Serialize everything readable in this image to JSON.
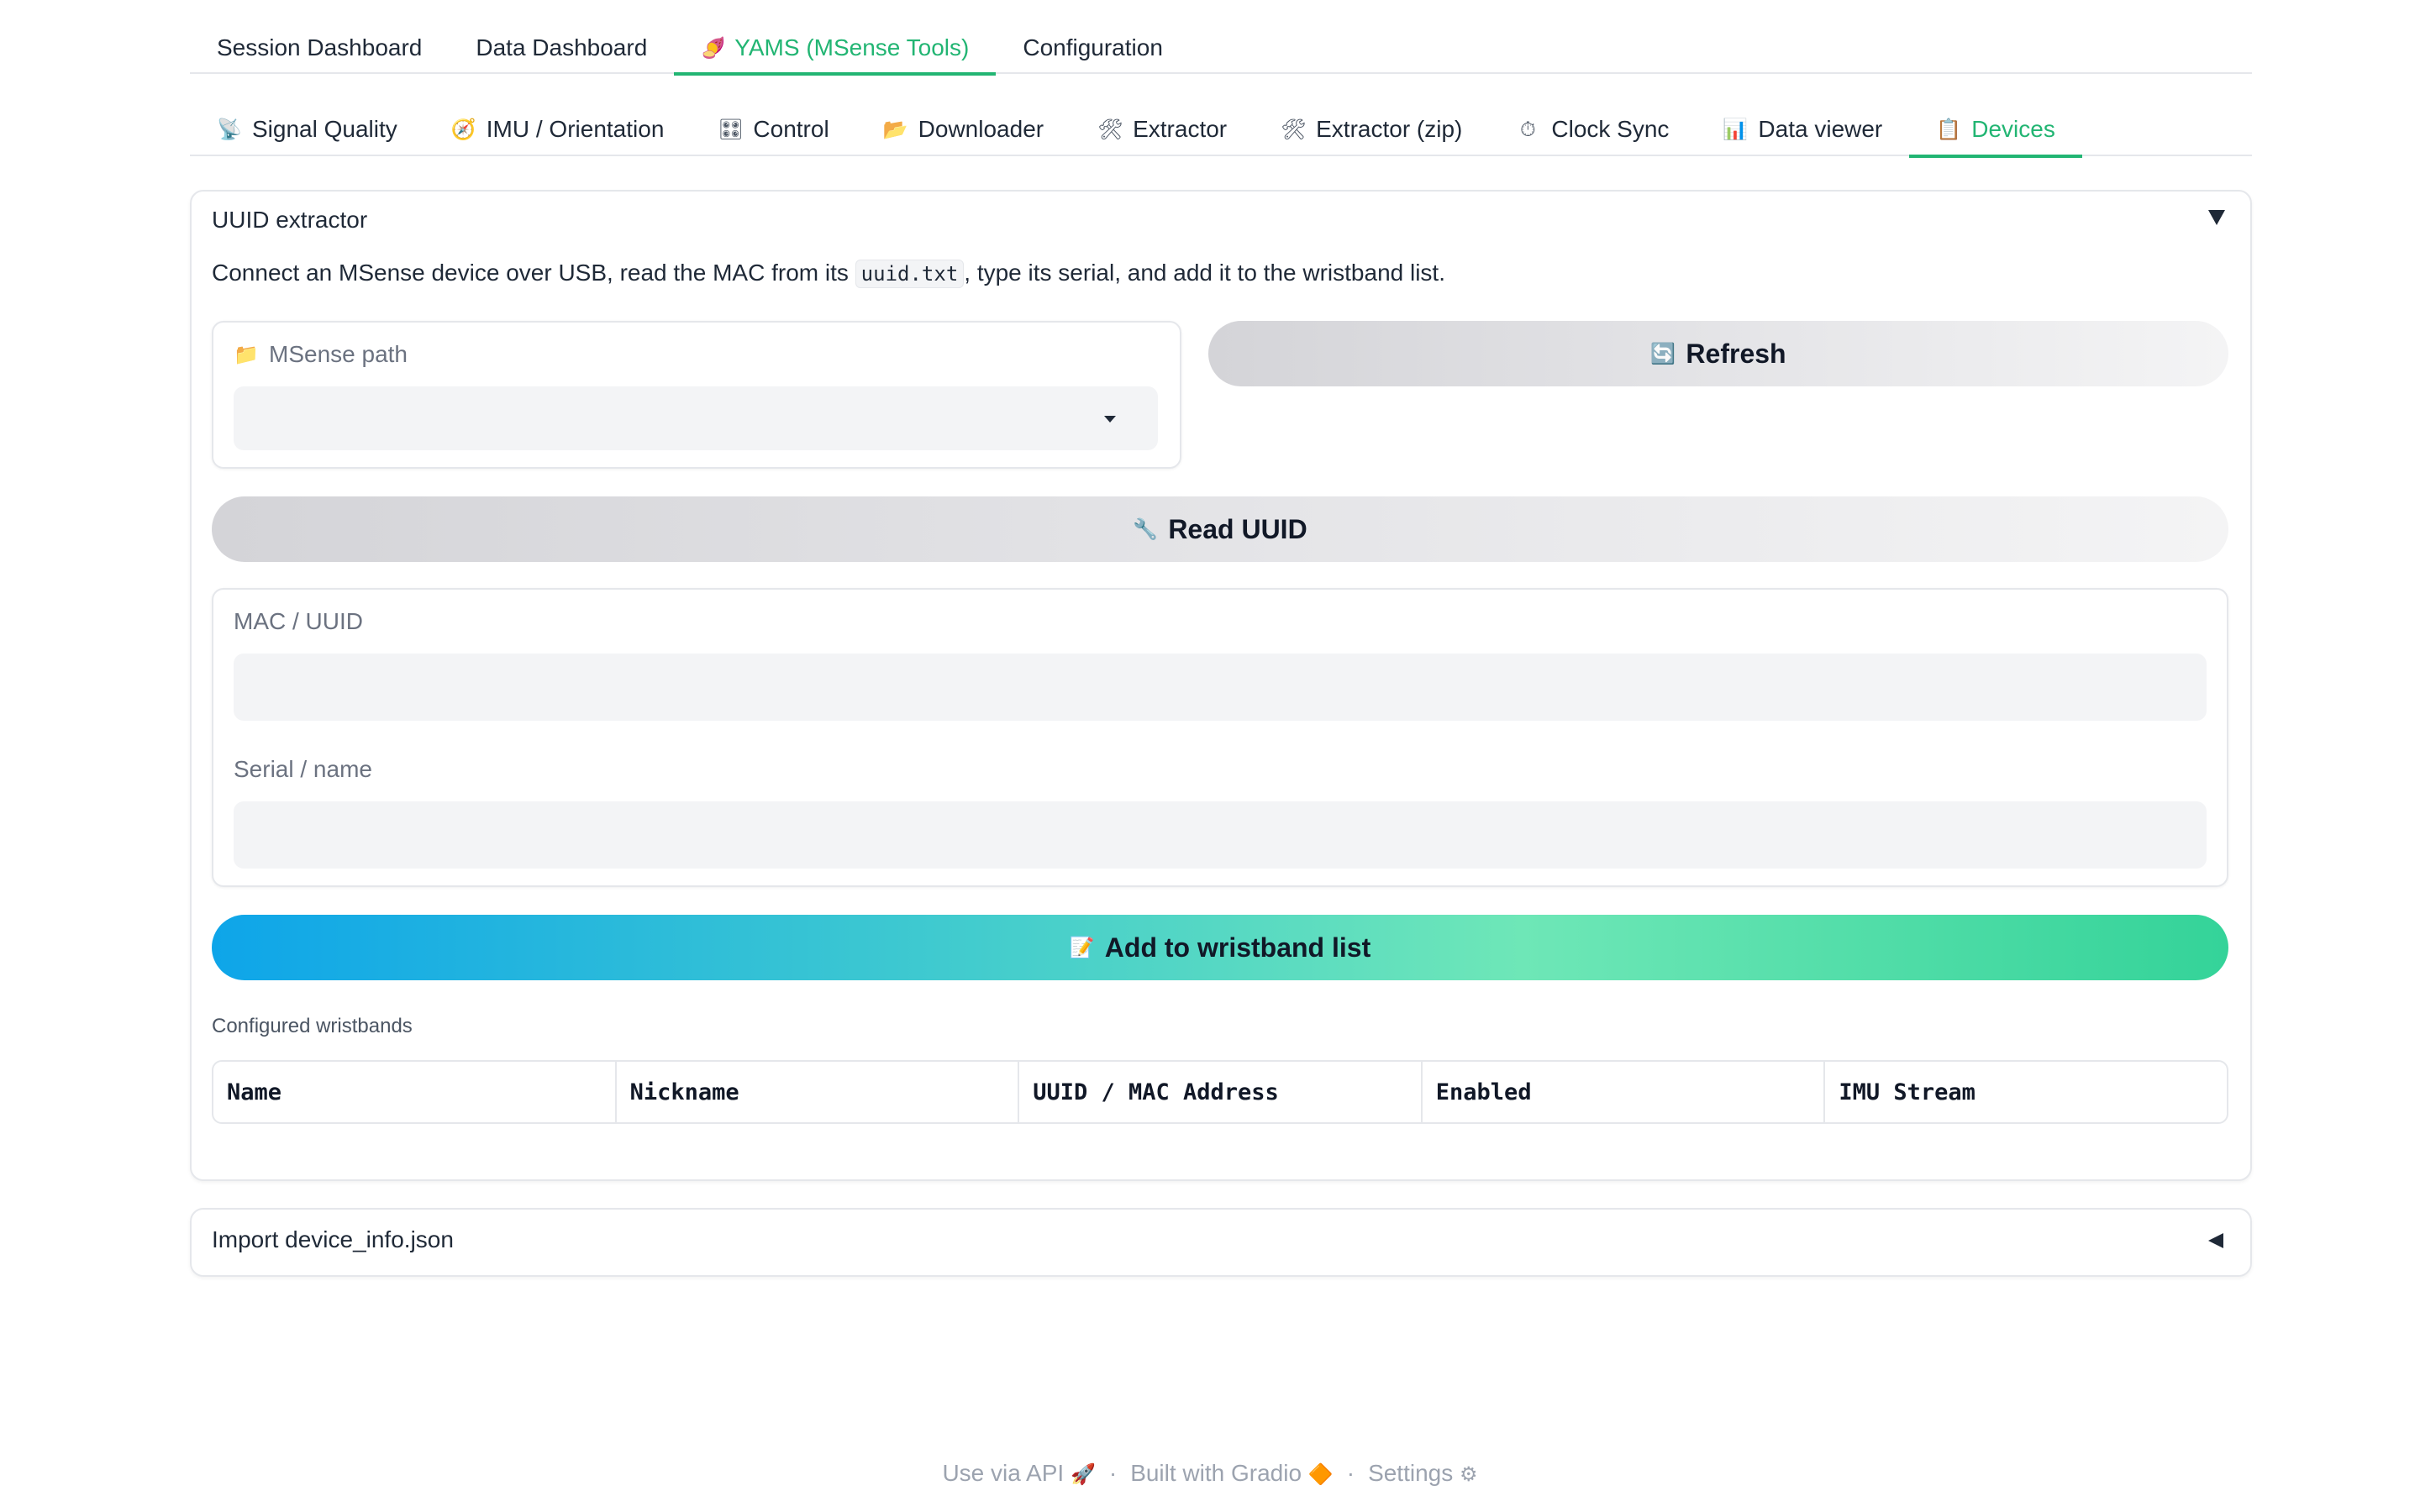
{
  "top_tabs": [
    {
      "label": "Session Dashboard",
      "icon": ""
    },
    {
      "label": "Data Dashboard",
      "icon": ""
    },
    {
      "label": "YAMS (MSense Tools)",
      "icon": "🍠",
      "active": true
    },
    {
      "label": "Configuration",
      "icon": ""
    }
  ],
  "sub_tabs": [
    {
      "label": "Signal Quality",
      "icon": "📡"
    },
    {
      "label": "IMU / Orientation",
      "icon": "🧭"
    },
    {
      "label": "Control",
      "icon": "🎛"
    },
    {
      "label": "Downloader",
      "icon": "📂"
    },
    {
      "label": "Extractor",
      "icon": "🛠"
    },
    {
      "label": "Extractor (zip)",
      "icon": "🛠"
    },
    {
      "label": "Clock Sync",
      "icon": "⏱"
    },
    {
      "label": "Data viewer",
      "icon": "📊"
    },
    {
      "label": "Devices",
      "icon": "📋",
      "active": true
    }
  ],
  "uuid_panel": {
    "title": "UUID extractor",
    "desc_before": "Connect an MSense device over USB, read the MAC from its ",
    "desc_code": "uuid.txt",
    "desc_after": ", type its serial, and add it to the wristband list.",
    "path_label": "MSense path",
    "path_icon": "📁",
    "path_value": "",
    "refresh_label": "Refresh",
    "refresh_icon": "🔄",
    "read_label": "Read UUID",
    "read_icon": "🔧",
    "mac_label": "MAC / UUID",
    "mac_value": "",
    "serial_label": "Serial / name",
    "serial_value": "",
    "add_label": "Add to wristband list",
    "add_icon": "📝",
    "configured_label": "Configured wristbands",
    "table_headers": [
      "Name",
      "Nickname",
      "UUID / MAC Address",
      "Enabled",
      "IMU Stream"
    ]
  },
  "import_panel": {
    "title": "Import device_info.json"
  },
  "footer": {
    "api": "Use via API",
    "api_icon": "🚀",
    "gradio": "Built with Gradio",
    "gradio_icon": "🔶",
    "settings": "Settings",
    "settings_icon": "⚙",
    "separator": "·"
  },
  "colors": {
    "accent": "#22b573",
    "add_gradient_start": "#0ea5e9",
    "add_gradient_end": "#34d399"
  }
}
